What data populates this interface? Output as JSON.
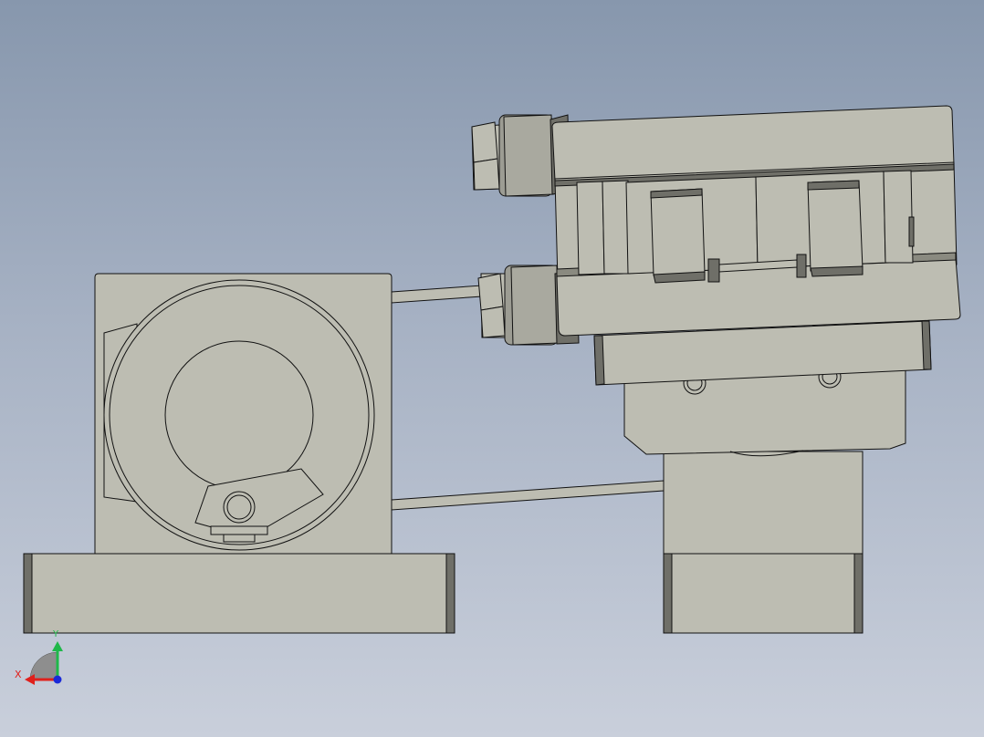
{
  "viewport": {
    "background_top": "#8797ad",
    "background_bottom": "#c9cfdb",
    "part_color": "#bdbdb2",
    "edge_color": "#111111",
    "dark_face_color": "#6f6f68"
  },
  "triad": {
    "x_label": "X",
    "y_label": "Y",
    "x_color": "#e0201c",
    "y_color": "#1fb84a",
    "z_color": "#1a2ad8"
  }
}
